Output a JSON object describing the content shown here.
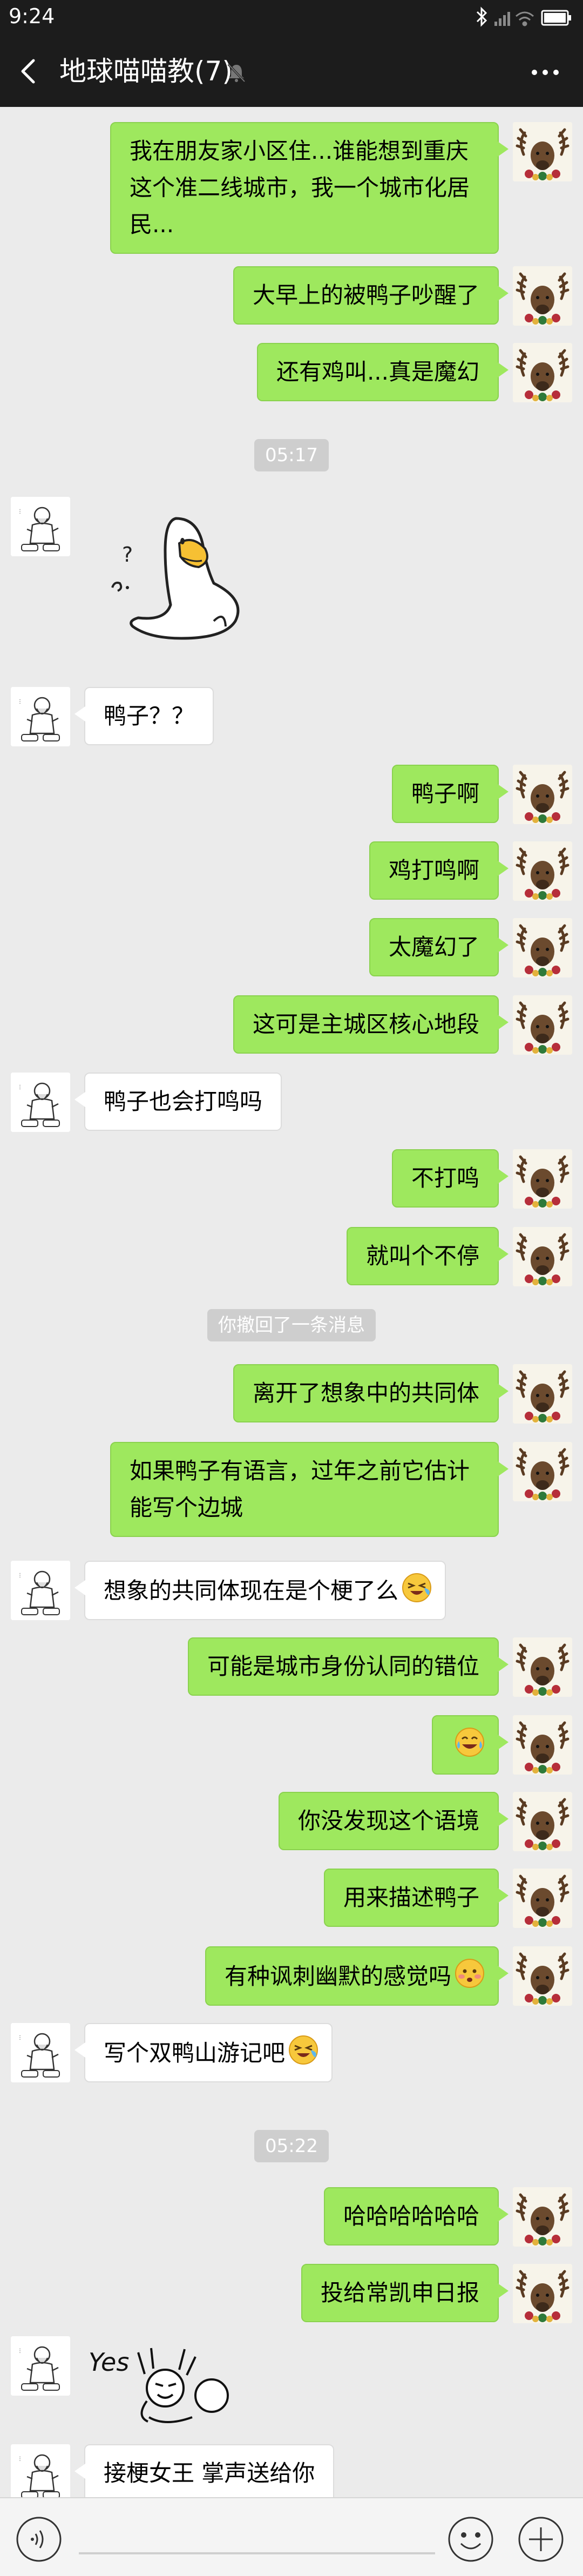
{
  "status_bar": {
    "time": "9:24"
  },
  "header": {
    "title": "地球喵喵教(7)"
  },
  "messages": [
    {
      "dir": "out",
      "text": "我在朋友家小区住...谁能想到重庆这个准二线城市，我一个城市化居民..."
    },
    {
      "dir": "out",
      "text": "大早上的被鸭子吵醒了"
    },
    {
      "dir": "out",
      "text": "还有鸡叫...真是魔幻"
    },
    {
      "type": "time",
      "text": "05:17"
    },
    {
      "dir": "in",
      "type": "sticker",
      "sticker": "duck-sticker"
    },
    {
      "dir": "in",
      "text": "鸭子？？"
    },
    {
      "dir": "out",
      "text": "鸭子啊"
    },
    {
      "dir": "out",
      "text": "鸡打鸣啊"
    },
    {
      "dir": "out",
      "text": "太魔幻了"
    },
    {
      "dir": "out",
      "text": "这可是主城区核心地段"
    },
    {
      "dir": "in",
      "text": "鸭子也会打鸣吗"
    },
    {
      "dir": "out",
      "text": "不打鸣"
    },
    {
      "dir": "out",
      "text": "就叫个不停"
    },
    {
      "type": "system",
      "text": "你撤回了一条消息"
    },
    {
      "dir": "out",
      "text": "离开了想象中的共同体"
    },
    {
      "dir": "out",
      "text": "如果鸭子有语言，过年之前它估计能写个边城"
    },
    {
      "dir": "in",
      "text": "想象的共同体现在是个梗了么",
      "emoji": "laugh-cry-emoji"
    },
    {
      "dir": "out",
      "text": "可能是城市身份认同的错位"
    },
    {
      "dir": "out",
      "text": "",
      "emoji": "tears-of-joy-emoji"
    },
    {
      "dir": "out",
      "text": "你没发现这个语境"
    },
    {
      "dir": "out",
      "text": "用来描述鸭子"
    },
    {
      "dir": "out",
      "text": "有种讽刺幽默的感觉吗",
      "emoji": "blush-emoji"
    },
    {
      "dir": "in",
      "text": "写个双鸭山游记吧",
      "emoji": "laugh-cry-emoji"
    },
    {
      "type": "time",
      "text": "05:22"
    },
    {
      "dir": "out",
      "text": "哈哈哈哈哈哈"
    },
    {
      "dir": "out",
      "text": "投给常凯申日报"
    },
    {
      "dir": "in",
      "type": "sticker",
      "sticker": "yes-sticker",
      "sticker_text": "Yes"
    },
    {
      "dir": "in",
      "text": "接梗女王 掌声送给你"
    }
  ],
  "icons": {
    "back": "back-arrow-icon",
    "mute": "mute-bell-icon",
    "more": "more-dots-icon",
    "voice": "voice-icon",
    "emoji": "emoji-face-icon",
    "plus": "plus-icon"
  },
  "colors": {
    "header_bg": "#1c1c1c",
    "chat_bg": "#ebebeb",
    "out_bubble": "#9ee85e",
    "in_bubble": "#ffffff"
  }
}
